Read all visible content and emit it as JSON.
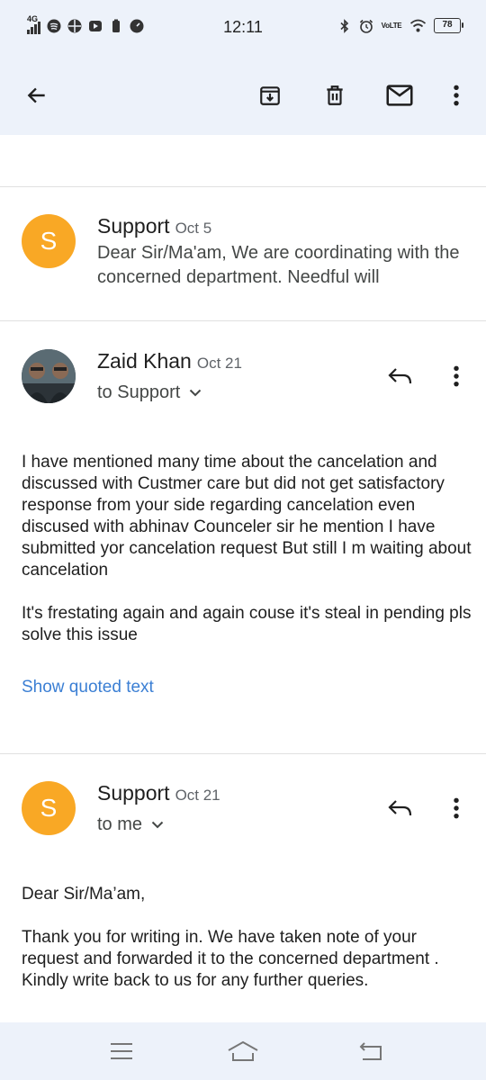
{
  "status_bar": {
    "time": "12:11",
    "network": "4G",
    "volte": "VoLTE",
    "battery": "78",
    "left_icons": [
      "signal-icon",
      "spotify-icon",
      "app-icon",
      "youtube-icon",
      "battery-saver-icon",
      "speed-icon"
    ],
    "right_icons": [
      "bluetooth-icon",
      "alarm-icon",
      "volte-icon",
      "wifi-icon",
      "battery-icon"
    ]
  },
  "toolbar": {
    "icons": [
      "back-arrow-icon",
      "archive-icon",
      "delete-icon",
      "mark-unread-icon",
      "more-vert-icon"
    ]
  },
  "messages": [
    {
      "sender": "Support",
      "date": "Oct 5",
      "avatar_letter": "S",
      "snippet": "Dear Sir/Ma'am, We are coordinating with the concerned department. Needful will",
      "collapsed": true
    },
    {
      "sender": "Zaid Khan",
      "date": "Oct 21",
      "recipient": "to Support",
      "body": [
        "I have mentioned many time about the cancelation and discussed with Custmer care but did not get satisfactory response from your side regarding cancelation even discused with abhinav Counceler  sir he mention I have submitted yor cancelation request But still I m waiting about cancelation",
        "It's frestating again and again couse it's steal in pending pls solve this issue"
      ],
      "show_quoted": "Show quoted text"
    },
    {
      "sender": "Support",
      "date": "Oct 21",
      "avatar_letter": "S",
      "recipient": "to me",
      "body": [
        "Dear Sir/Ma’am,",
        "Thank you for writing in. We have taken note of your request and forwarded it to the concerned department . Kindly write back to us for any further queries."
      ]
    }
  ],
  "nav_bar": {
    "icons": [
      "menu-icon",
      "home-icon",
      "back-icon"
    ]
  },
  "colors": {
    "header_bg": "#edf2fa",
    "avatar": "#f9a825",
    "link": "#3b7fd4"
  }
}
